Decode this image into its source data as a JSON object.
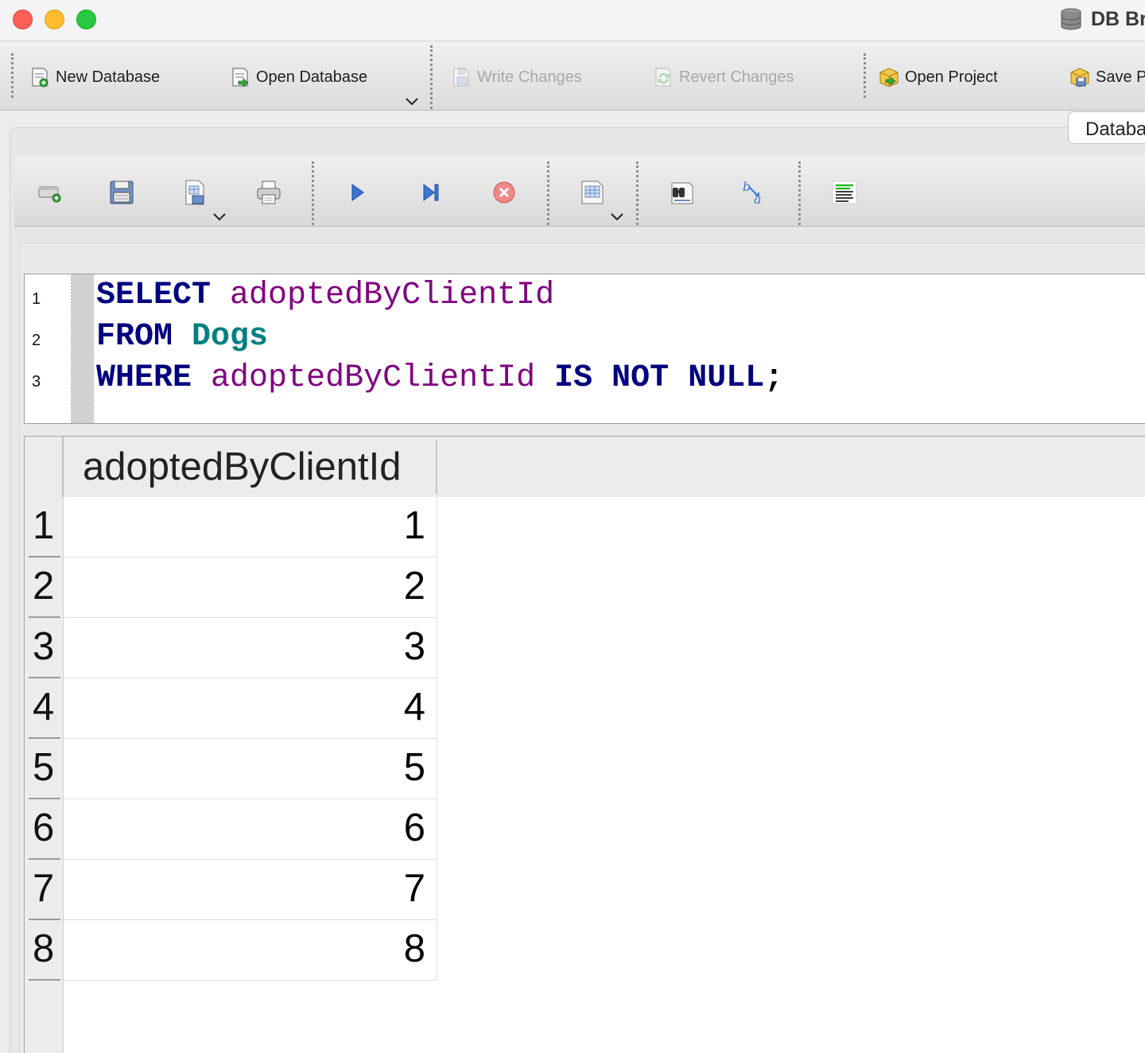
{
  "window": {
    "app_title": "DB Br"
  },
  "main_toolbar": {
    "new_database": "New Database",
    "open_database": "Open Database",
    "write_changes": "Write Changes",
    "revert_changes": "Revert Changes",
    "open_project": "Open Project",
    "save_project": "Save P"
  },
  "tabs": {
    "database_tab": "Databa"
  },
  "editor": {
    "line_numbers": [
      "1",
      "2",
      "3"
    ],
    "line1": {
      "keyword": "SELECT",
      "column": "adoptedByClientId"
    },
    "line2": {
      "keyword": "FROM",
      "table": "Dogs"
    },
    "line3": {
      "keyword_where": "WHERE",
      "column": "adoptedByClientId",
      "keyword_is": "IS",
      "keyword_not": "NOT",
      "keyword_null": "NULL",
      "terminator": ";"
    }
  },
  "results": {
    "columns": [
      "adoptedByClientId"
    ],
    "row_numbers": [
      "1",
      "2",
      "3",
      "4",
      "5",
      "6",
      "7",
      "8"
    ],
    "rows": [
      [
        "1"
      ],
      [
        "2"
      ],
      [
        "3"
      ],
      [
        "4"
      ],
      [
        "5"
      ],
      [
        "6"
      ],
      [
        "7"
      ],
      [
        "8"
      ]
    ]
  },
  "colors": {
    "sql_keyword": "#000080",
    "sql_identifier": "#800080",
    "sql_table": "#008080",
    "close_red": "#ff5f57",
    "minimize_yellow": "#febc2e",
    "zoom_green": "#28c840"
  },
  "icons": {
    "toolbar": [
      "new-database-icon",
      "open-database-icon",
      "write-changes-icon",
      "revert-changes-icon",
      "open-project-icon",
      "save-project-icon"
    ],
    "sql_toolbar": [
      "open-tab-icon",
      "save-sql-icon",
      "save-results-icon",
      "print-icon",
      "execute-all-icon",
      "execute-line-icon",
      "stop-icon",
      "results-view-icon",
      "find-icon",
      "find-replace-icon",
      "comment-icon"
    ]
  }
}
